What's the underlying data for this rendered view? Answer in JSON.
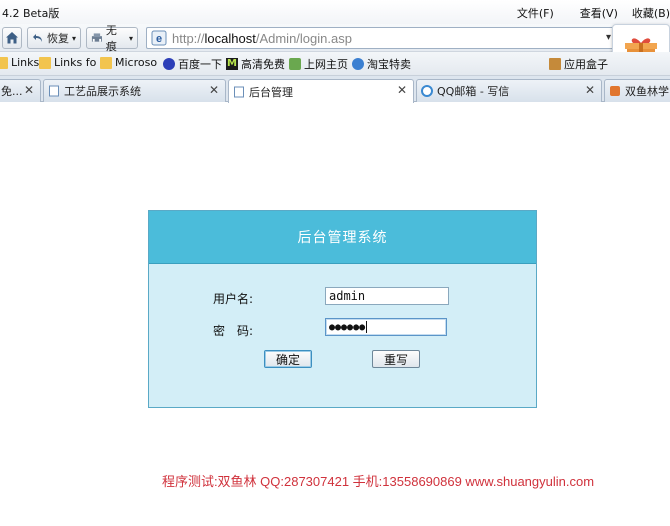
{
  "browser": {
    "app_title": "4.2 Beta版",
    "menu": [
      "文件(F)",
      "查看(V)",
      "收藏(B)"
    ],
    "toolbar": {
      "restore_label": "恢复",
      "clean_label": "无痕"
    },
    "address": {
      "prefix": "http://",
      "host": "localhost",
      "path": "/Admin/login.asp"
    },
    "favorites": [
      "Links",
      "Links fo",
      "Microso",
      "百度一下",
      "高清免费",
      "上网主页",
      "淘宝特卖",
      "应用盒子"
    ],
    "tabs": [
      {
        "label": "免...",
        "active": false
      },
      {
        "label": "工艺品展示系统",
        "active": false
      },
      {
        "label": "后台管理",
        "active": true
      },
      {
        "label": "QQ邮箱 - 写信",
        "active": false
      },
      {
        "label": "双鱼林学习",
        "active": false
      }
    ]
  },
  "login": {
    "title": "后台管理系统",
    "username_label": "用户名:",
    "username_value": "admin",
    "password_label": "密　码:",
    "password_value": "●●●●●●",
    "submit_label": "确定",
    "reset_label": "重写"
  },
  "footer": {
    "text": "程序测试:双鱼林 QQ:287307421 手机:13558690869 www.shuangyulin.com"
  },
  "colors": {
    "panel_header": "#4bbcda",
    "panel_body": "#d3eef7",
    "footer_text": "#d0323c"
  }
}
